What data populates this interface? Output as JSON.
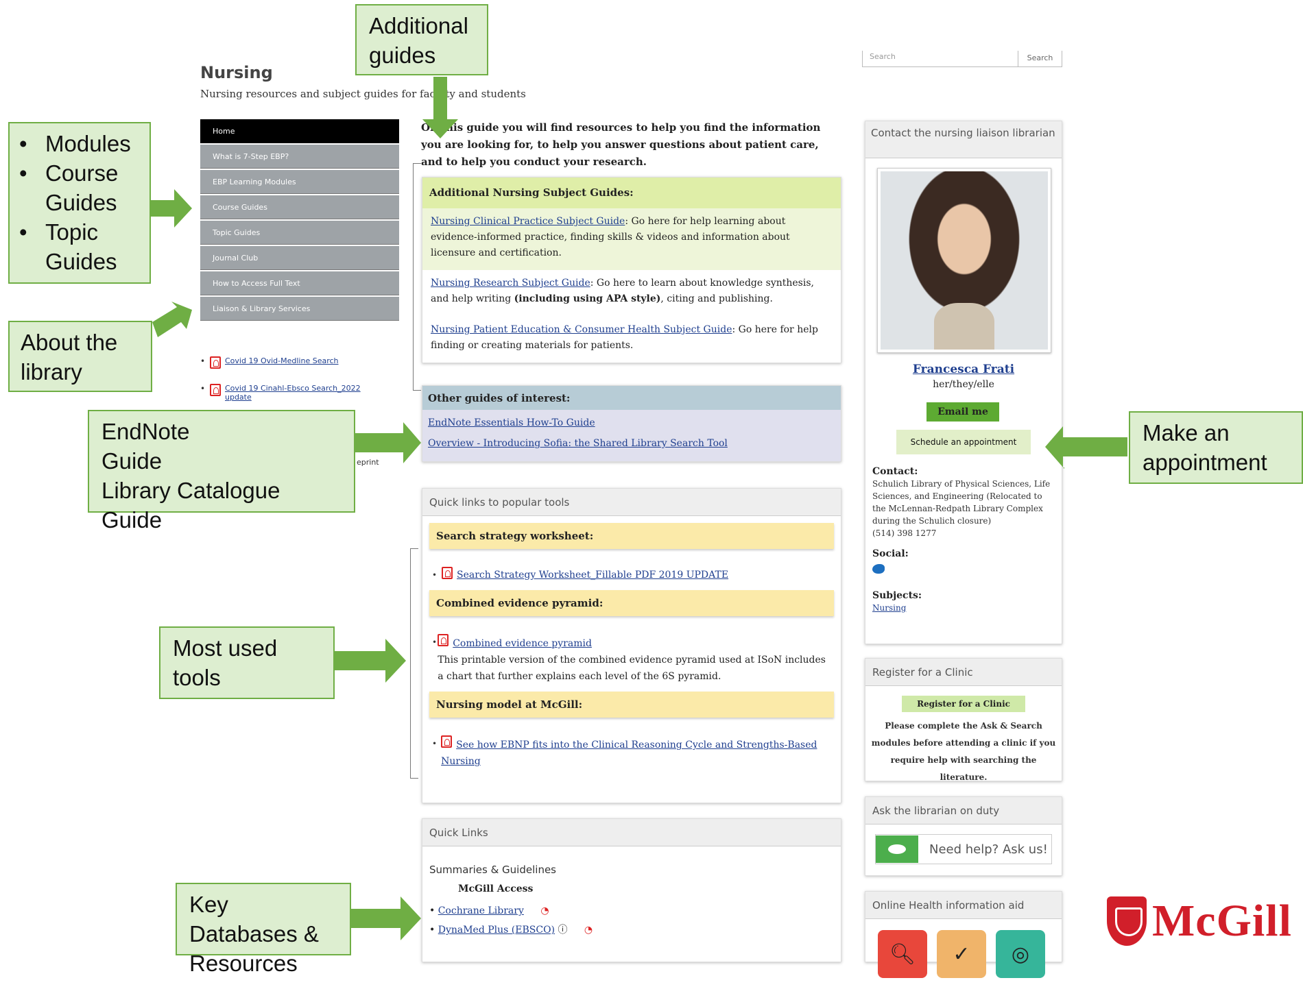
{
  "header": {
    "title": "Nursing",
    "subtitle": "Nursing resources and subject guides for faculty and students",
    "search_placeholder": "Search",
    "search_button": "Search"
  },
  "nav": [
    "Home",
    "What is 7-Step EBP?",
    "EBP Learning Modules",
    "Course Guides",
    "Topic Guides",
    "Journal Club",
    "How to Access Full Text",
    "Liaison & Library Services"
  ],
  "side_links": [
    "Covid 19 Ovid-Medline Search",
    "Covid 19 Cinahl-Ebsco Search_2022 update"
  ],
  "side_eprint": "eprint",
  "intro": "On this guide you will find resources to help you find the information you are looking for, to help you answer questions about patient care, and to help you conduct your research.",
  "subject_guides": {
    "heading": "Additional Nursing Subject Guides:",
    "items": [
      {
        "link": "Nursing Clinical Practice Subject Guide",
        "text": ": Go here for help learning about evidence-informed practice, finding skills & videos and information about licensure and certification."
      },
      {
        "link": "Nursing Research Subject Guide",
        "text": ": Go here to learn about knowledge synthesis, and help writing ",
        "bold": "(including using APA style)",
        "text2": ", citing and publishing."
      },
      {
        "link": "Nursing Patient Education & Consumer Health Subject Guide",
        "text": ": Go here for help finding or creating materials for patients."
      }
    ]
  },
  "other_guides": {
    "heading": "Other guides of interest:",
    "items": [
      "EndNote Essentials How-To Guide",
      "Overview - Introducing Sofia: the Shared Library Search Tool"
    ]
  },
  "quick_tools": {
    "heading": "Quick links to popular tools",
    "sections": [
      {
        "title": "Search strategy worksheet:",
        "link": "Search Strategy Worksheet_Fillable PDF 2019 UPDATE",
        "desc": ""
      },
      {
        "title": "Combined evidence pyramid:",
        "link": "Combined evidence pyramid",
        "desc": "This printable version of the combined evidence pyramid used at ISoN includes a chart that further explains each level of the 6S pyramid."
      },
      {
        "title": "Nursing model at McGill:",
        "link": "See how EBNP fits into the Clinical Reasoning Cycle and Strengths-Based Nursing",
        "desc": ""
      }
    ]
  },
  "quick_links": {
    "heading": "Quick Links",
    "summaries": "Summaries & Guidelines",
    "access": "McGill Access",
    "items": [
      "Cochrane Library",
      "DynaMed Plus (EBSCO)"
    ]
  },
  "contact": {
    "heading": "Contact the nursing liaison librarian",
    "name": "Francesca Frati",
    "pronouns": "her/they/elle",
    "email_btn": "Email me",
    "schedule_btn": "Schedule an appointment",
    "contact_label": "Contact:",
    "contact_text": "Schulich Library of Physical Sciences, Life Sciences, and Engineering (Relocated to the McLennan-Redpath Library Complex during the Schulich closure)",
    "phone": "(514) 398 1277",
    "social_label": "Social:",
    "subjects_label": "Subjects:",
    "subject": "Nursing"
  },
  "clinic": {
    "heading": "Register for a Clinic",
    "button": "Register for a Clinic",
    "text": "Please complete the Ask & Search modules before attending a clinic if you require help with searching the literature."
  },
  "ask": {
    "heading": "Ask the librarian on duty",
    "button": "Need help? Ask us!"
  },
  "online": {
    "heading": "Online Health information aid"
  },
  "callouts": {
    "additional_guides": "Additional guides",
    "modules": [
      "Modules",
      "Course Guides",
      "Topic Guides"
    ],
    "about_library": "About the library",
    "endnote": [
      "EndNote",
      "Guide",
      "Library Catalogue Guide"
    ],
    "most_used": "Most used tools",
    "key_db": "Key Databases & Resources",
    "appointment": "Make an appointment"
  },
  "logo": "McGill",
  "colors": {
    "callout_fill": "#ddeed0",
    "callout_border": "#6fae44",
    "arrow": "#6fae44",
    "mcgill_red": "#d11f2a",
    "nav_active": "#000000",
    "nav_gray": "#9ea3a7"
  }
}
